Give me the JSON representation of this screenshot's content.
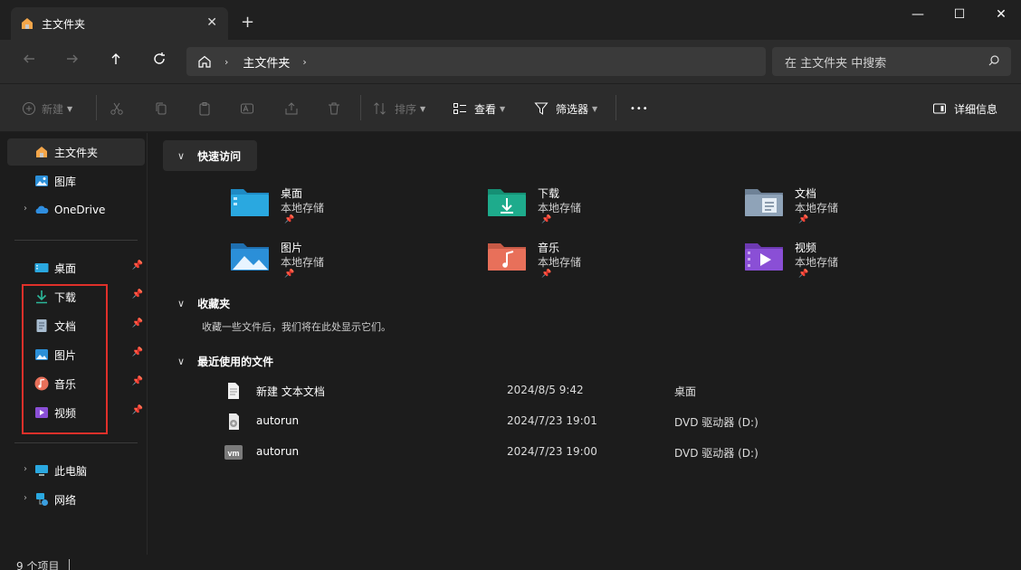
{
  "tab": {
    "title": "主文件夹",
    "close_icon": "close-icon",
    "new_tab_icon": "plus-icon"
  },
  "window": {
    "minimize_glyph": "—",
    "maximize_glyph": "☐",
    "close_glyph": "✕"
  },
  "nav": {
    "back_icon": "back-arrow-icon",
    "forward_icon": "forward-arrow-icon",
    "up_icon": "up-arrow-icon",
    "refresh_icon": "refresh-icon",
    "breadcrumb": "主文件夹",
    "search_placeholder": "在 主文件夹 中搜索"
  },
  "toolbar": {
    "new_label": "新建",
    "sort_label": "排序",
    "view_label": "查看",
    "filter_label": "筛选器",
    "more_label": "•••",
    "details_label": "详细信息"
  },
  "sidebar": {
    "home": "主文件夹",
    "gallery": "图库",
    "onedrive": "OneDrive",
    "pinned": [
      {
        "label": "桌面",
        "icon": "desktop-icon"
      },
      {
        "label": "下载",
        "icon": "download-icon"
      },
      {
        "label": "文档",
        "icon": "document-icon"
      },
      {
        "label": "图片",
        "icon": "pictures-icon"
      },
      {
        "label": "音乐",
        "icon": "music-icon"
      },
      {
        "label": "视频",
        "icon": "video-icon"
      }
    ],
    "this_pc": "此电脑",
    "network": "网络"
  },
  "main": {
    "quick_access": {
      "header": "快速访问",
      "items": [
        {
          "name": "桌面",
          "sub": "本地存储",
          "icon": "desktop-folder-icon",
          "color": "#2aa8e0"
        },
        {
          "name": "下载",
          "sub": "本地存储",
          "icon": "downloads-folder-icon",
          "color": "#1eab8c"
        },
        {
          "name": "文档",
          "sub": "本地存储",
          "icon": "documents-folder-icon",
          "color": "#8fa3b8"
        },
        {
          "name": "图片",
          "sub": "本地存储",
          "icon": "pictures-folder-icon",
          "color": "#2b8fd8"
        },
        {
          "name": "音乐",
          "sub": "本地存储",
          "icon": "music-folder-icon",
          "color": "#e8705a"
        },
        {
          "name": "视频",
          "sub": "本地存储",
          "icon": "videos-folder-icon",
          "color": "#8a4fd6"
        }
      ]
    },
    "favorites": {
      "header": "收藏夹",
      "empty_text": "收藏一些文件后，我们将在此处显示它们。"
    },
    "recent": {
      "header": "最近使用的文件",
      "files": [
        {
          "name": "新建 文本文档",
          "date": "2024/8/5 9:42",
          "location": "桌面",
          "icon": "text-file-icon"
        },
        {
          "name": "autorun",
          "date": "2024/7/23 19:01",
          "location": "DVD 驱动器 (D:)",
          "icon": "setup-file-icon"
        },
        {
          "name": "autorun",
          "date": "2024/7/23 19:00",
          "location": "DVD 驱动器 (D:)",
          "icon": "vm-file-icon"
        }
      ]
    }
  },
  "status": {
    "count": "9 个项目"
  },
  "colors": {
    "accent": "#2aa8e0",
    "highlight_box": "#e0302a"
  }
}
